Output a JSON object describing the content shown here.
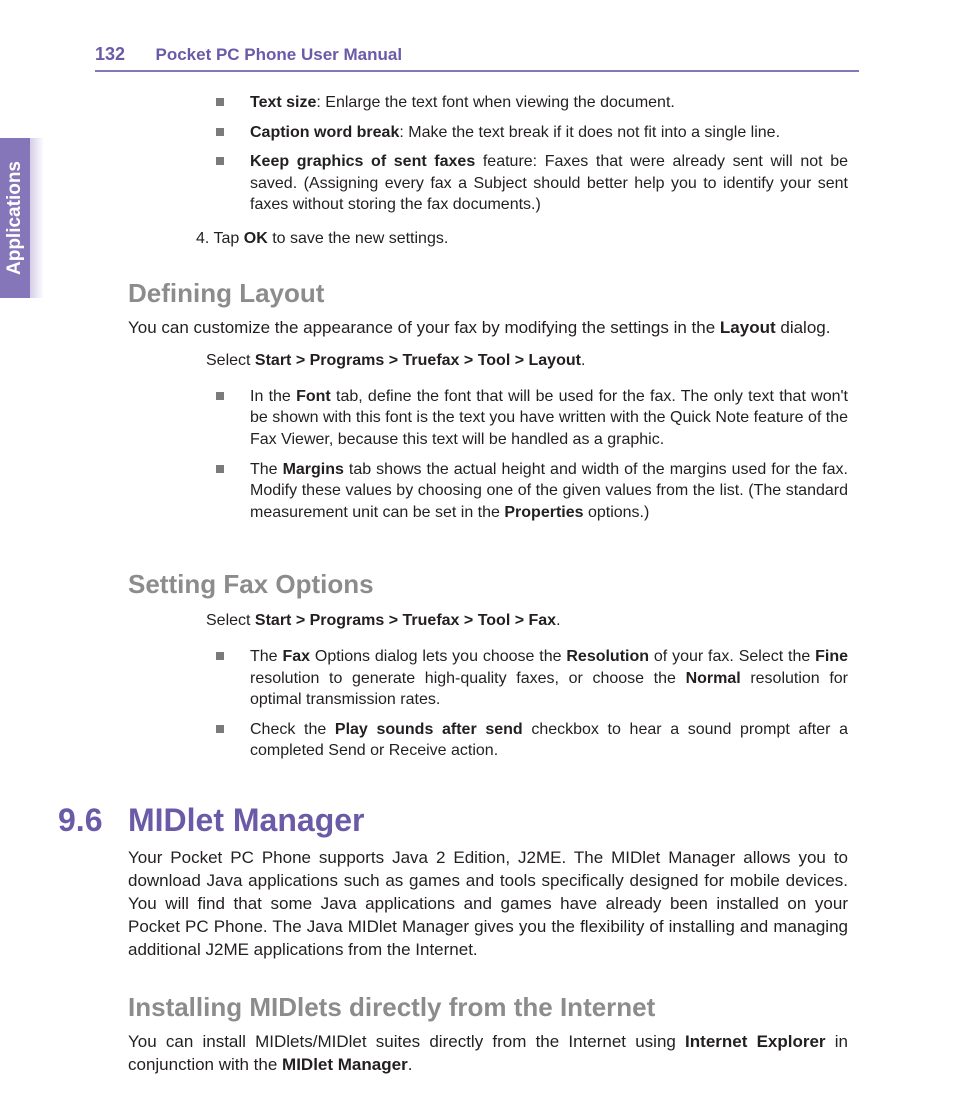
{
  "header": {
    "page_number": "132",
    "title": "Pocket PC Phone User Manual"
  },
  "side_tab": "Applications",
  "bullets_top": [
    {
      "bold": "Text size",
      "rest": ":  Enlarge the text font when viewing the document."
    },
    {
      "bold": "Caption word break",
      "rest": ":  Make the text break if it does not fit into a single line."
    },
    {
      "bold": " Keep graphics of sent faxes",
      "rest": " feature:  Faxes that were already sent will not be saved.  (Assigning every fax a Subject should better help you to identify your sent faxes without storing the fax documents.)"
    }
  ],
  "step4": {
    "num": "4.  ",
    "pre": "Tap ",
    "bold": "OK",
    "post": " to save the new settings."
  },
  "defining_layout": {
    "heading": "Defining Layout",
    "intro_pre": "You can customize the appearance of your fax by modifying the settings in the ",
    "intro_bold": "Layout",
    "intro_post": " dialog.",
    "select_pre": "Select ",
    "select_bold": "Start > Programs > Truefax > Tool > Layout",
    "select_post": ".",
    "bullets": [
      {
        "pre": "In the ",
        "b1": "Font",
        "post": " tab, define the font that will be used for the fax.  The only text that won't be shown with this font is the text you have written with the Quick Note feature of the Fax Viewer, because this text will be handled as a graphic."
      },
      {
        "pre": "The ",
        "b1": "Margins",
        "mid": " tab shows the actual height and width of the margins used for the fax.  Modify these values by choosing one of the given values from the list.  (The standard measurement unit can be set in the ",
        "b2": "Properties",
        "post": " options.)"
      }
    ]
  },
  "setting_fax": {
    "heading": "Setting Fax Options",
    "select_pre": "Select ",
    "select_bold": "Start > Programs > Truefax > Tool > Fax",
    "select_post": ".",
    "bullets": [
      {
        "pre": "The ",
        "b1": "Fax",
        "mid1": " Options dialog lets you choose the ",
        "b2": "Resolution",
        "mid2": " of your fax.  Select the ",
        "b3": "Fine",
        "mid3": " resolution to generate high-quality faxes, or choose the ",
        "b4": "Normal",
        "post": " resolution for optimal transmission rates."
      },
      {
        "pre": "Check the ",
        "b1": "Play sounds after send",
        "post": " checkbox to hear a sound prompt after a completed Send or Receive action."
      }
    ]
  },
  "midlet": {
    "chap_num": "9.6",
    "title": "MIDlet Manager",
    "intro": "Your Pocket PC Phone supports Java 2 Edition, J2ME.  The MIDlet Manager allows you to download Java applications such as games and tools specifically designed for mobile devices.  You will find that some Java applications and games have already been installed on your Pocket PC Phone.  The Java MIDlet Manager gives you the flexibility of installing and managing additional J2ME applications from the Internet.",
    "sub_heading": "Installing MIDlets directly from the Internet",
    "sub_intro_pre": "You can install MIDlets/MIDlet suites directly from the Internet using ",
    "sub_intro_b1": "Internet Explorer",
    "sub_intro_mid": " in conjunction with the ",
    "sub_intro_b2": "MIDlet Manager",
    "sub_intro_post": "."
  }
}
